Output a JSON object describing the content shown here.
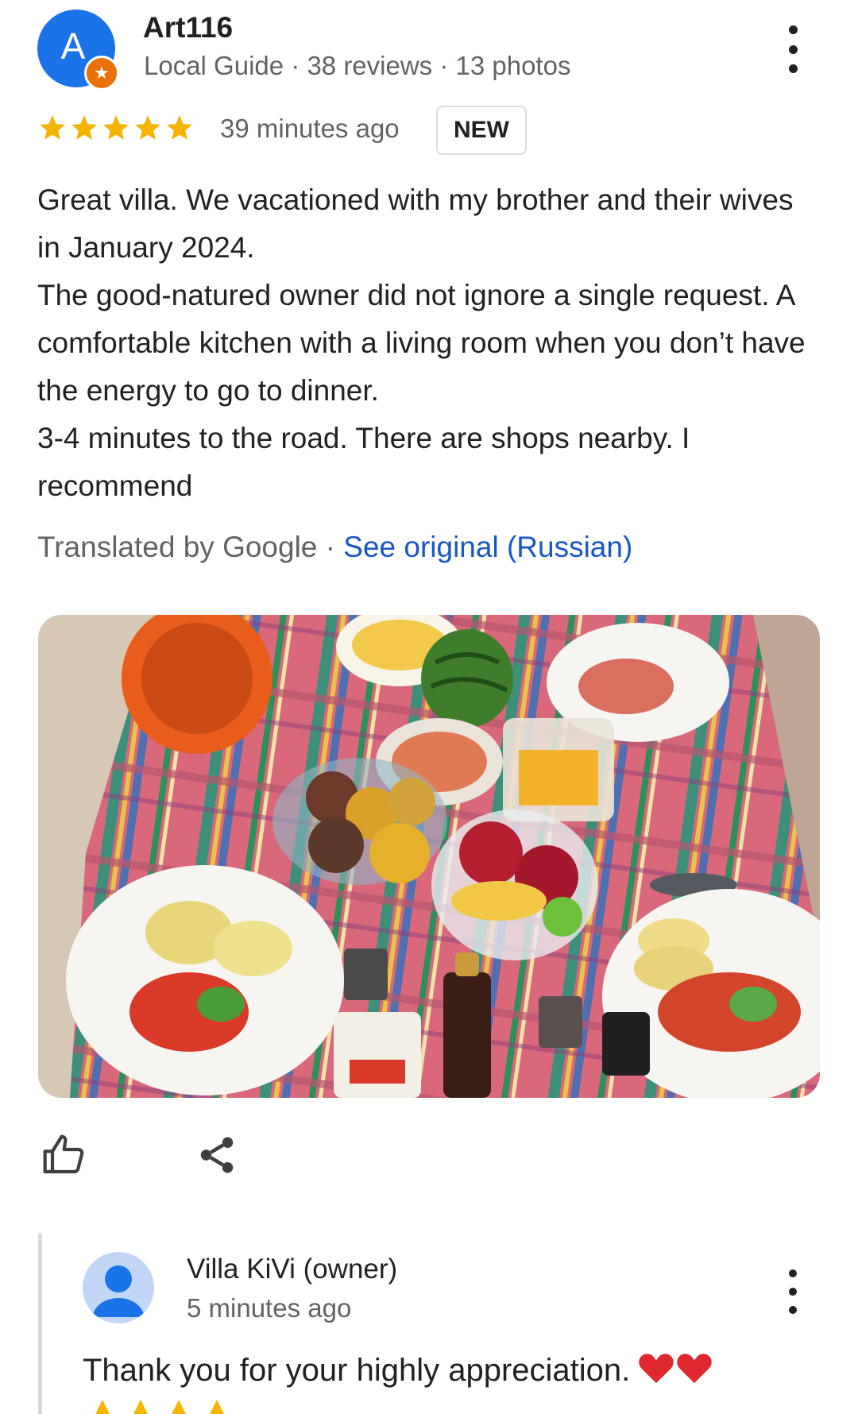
{
  "author": {
    "initial": "A",
    "name": "Art116",
    "meta": "Local Guide · 38 reviews · 13 photos"
  },
  "review": {
    "rating": 5,
    "time": "39 minutes ago",
    "badge": "NEW",
    "paragraphs": [
      "Great villa. We vacationed with my brother and their wives in January 2024.",
      "The good-natured owner did not ignore a single request. A comfortable kitchen with a living room when you don’t have the energy to go to dinner.",
      "3-4 minutes to the road. There are shops nearby. I recommend"
    ],
    "translated_by": "Translated by Google · ",
    "see_original": "See original (Russian)"
  },
  "reply": {
    "owner_name": "Villa KiVi (owner)",
    "time": "5 minutes ago",
    "text": "Thank you for your highly appreciation."
  },
  "colors": {
    "accent_blue": "#1a73e8",
    "link_blue": "#1a56c4",
    "star_yellow": "#f5b400",
    "guide_orange": "#e8710a"
  }
}
